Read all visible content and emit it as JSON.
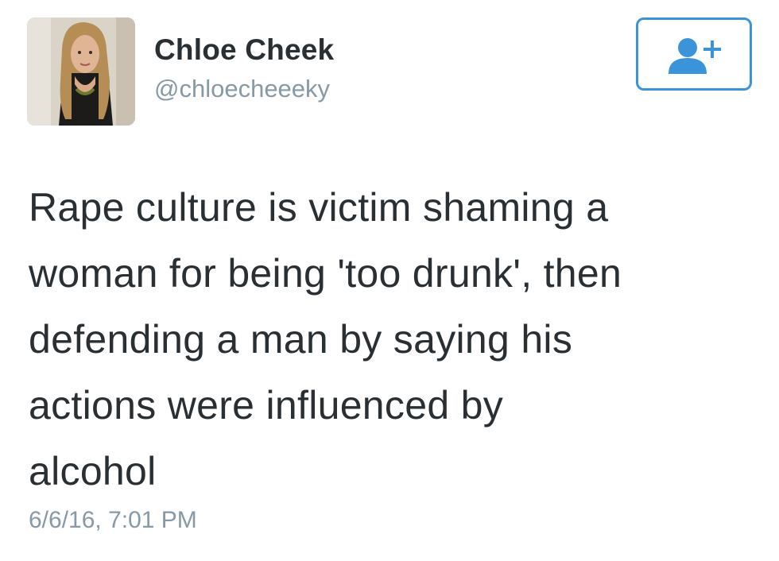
{
  "tweet": {
    "author": {
      "display_name": "Chloe Cheek",
      "handle": "@chloecheeeky"
    },
    "follow_button": {
      "icon": "add-user-icon",
      "color": "#3b94d9"
    },
    "text": "Rape culture is victim shaming a\nwoman for being 'too drunk', then\ndefending a man by saying his\nactions were influenced by\nalcohol",
    "timestamp": "6/6/16, 7:01 PM"
  },
  "colors": {
    "text": "#292f33",
    "secondary": "#8899a6",
    "accent": "#3b94d9"
  }
}
